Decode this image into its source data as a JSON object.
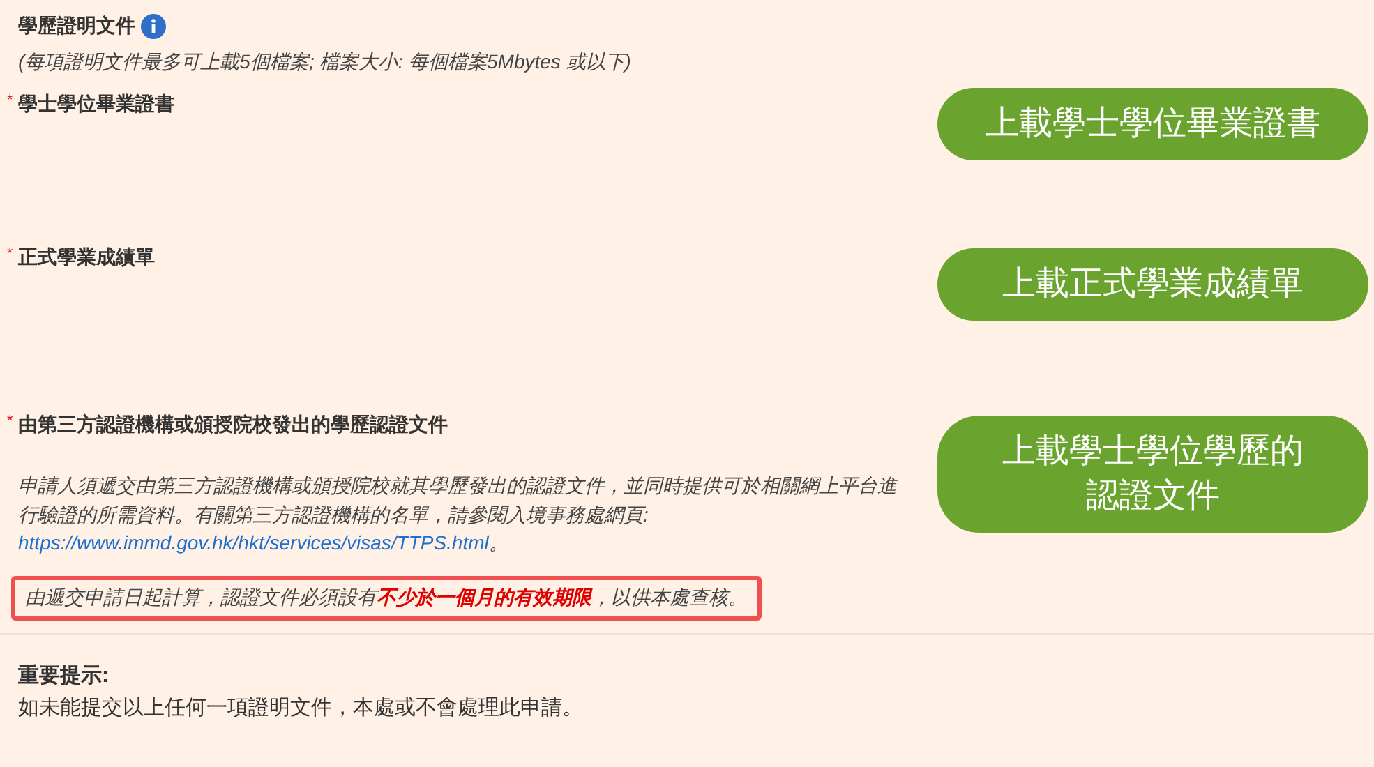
{
  "section": {
    "title": "學歷證明文件",
    "hint": "(每項證明文件最多可上載5個檔案; 檔案大小: 每個檔案5Mbytes 或以下)"
  },
  "items": [
    {
      "required_mark": "*",
      "label": "學士學位畢業證書",
      "button": [
        "上載學士學位畢業證書"
      ]
    },
    {
      "required_mark": "*",
      "label": "正式學業成績單",
      "button": [
        "上載正式學業成績單"
      ]
    },
    {
      "required_mark": "*",
      "label": "由第三方認證機構或頒授院校發出的學歷認證文件",
      "button": [
        "上載學士學位學歷的",
        "認證文件"
      ],
      "description": {
        "text": "申請人須遞交由第三方認證機構或頒授院校就其學歷發出的認證文件，並同時提供可於相關網上平台進行驗證的所需資料。有關第三方認證機構的名單，請參閱入境事務處網頁:",
        "link": "https://www.immd.gov.hk/hkt/services/visas/TTPS.html",
        "after": "。"
      },
      "warning": "由遞交申請日起計算，認證文件必須設有**不少於一個月的有效期限**，以供本處查核。"
    }
  ],
  "notice": {
    "title": "重要提示:",
    "text": "如未能提交以上任何一項證明文件，本處或不會處理此申請。"
  }
}
